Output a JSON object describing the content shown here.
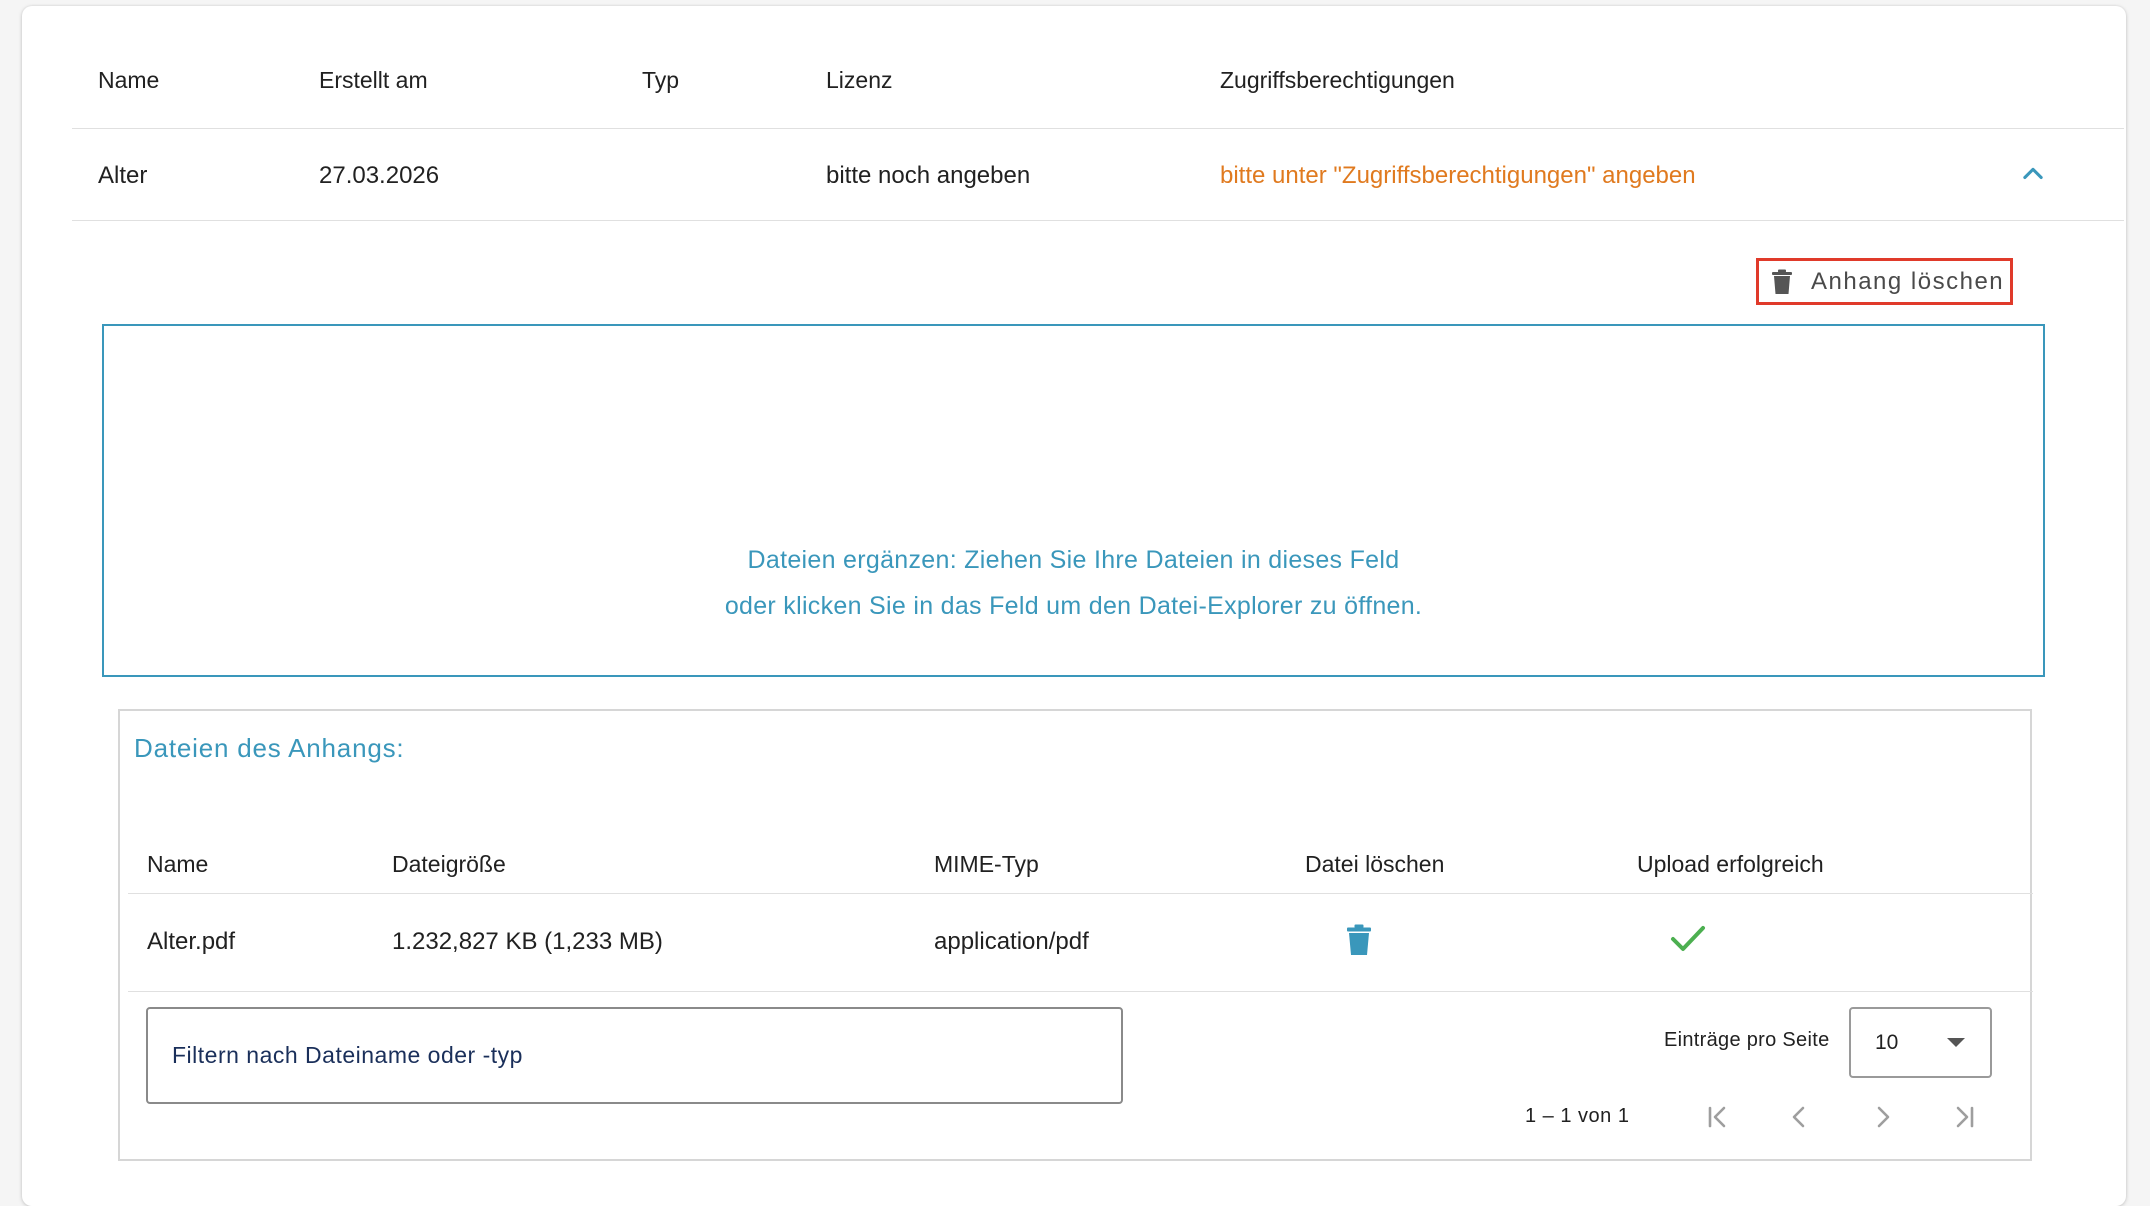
{
  "outer_table": {
    "columns": [
      "Name",
      "Erstellt am",
      "Typ",
      "Lizenz",
      "Zugriffsberechtigungen"
    ],
    "row": {
      "name": "Alter",
      "created": "27.03.2026",
      "type": "",
      "license": "bitte noch angeben",
      "access": "bitte unter \"Zugriffsberechtigungen\" angeben"
    },
    "expand_icon": "chevron-up-icon"
  },
  "attachment": {
    "delete_label": "Anhang löschen",
    "delete_icon": "trash-icon",
    "highlight_color": "#e03a2a"
  },
  "dropzone": {
    "line1": "Dateien ergänzen: Ziehen Sie Ihre Dateien in dieses Feld",
    "line2": "oder klicken Sie in das Feld um den Datei-Explorer zu öffnen.",
    "color": "#3a97bb"
  },
  "files": {
    "title": "Dateien des Anhangs:",
    "columns": [
      "Name",
      "Dateigröße",
      "MIME-Typ",
      "Datei löschen",
      "Upload erfolgreich"
    ],
    "rows": [
      {
        "name": "Alter.pdf",
        "size": "1.232,827 KB (1,233 MB)",
        "mime": "application/pdf",
        "delete_icon": "trash-icon",
        "upload_icon": "check-icon"
      }
    ],
    "filter_placeholder": "Filtern nach Dateiname oder -typ",
    "per_page_label": "Einträge pro Seite",
    "per_page_value": "10",
    "range": "1 – 1 von 1"
  },
  "colors": {
    "accent": "#3a97bb",
    "warning": "#e07a1f",
    "success": "#4caf50"
  }
}
